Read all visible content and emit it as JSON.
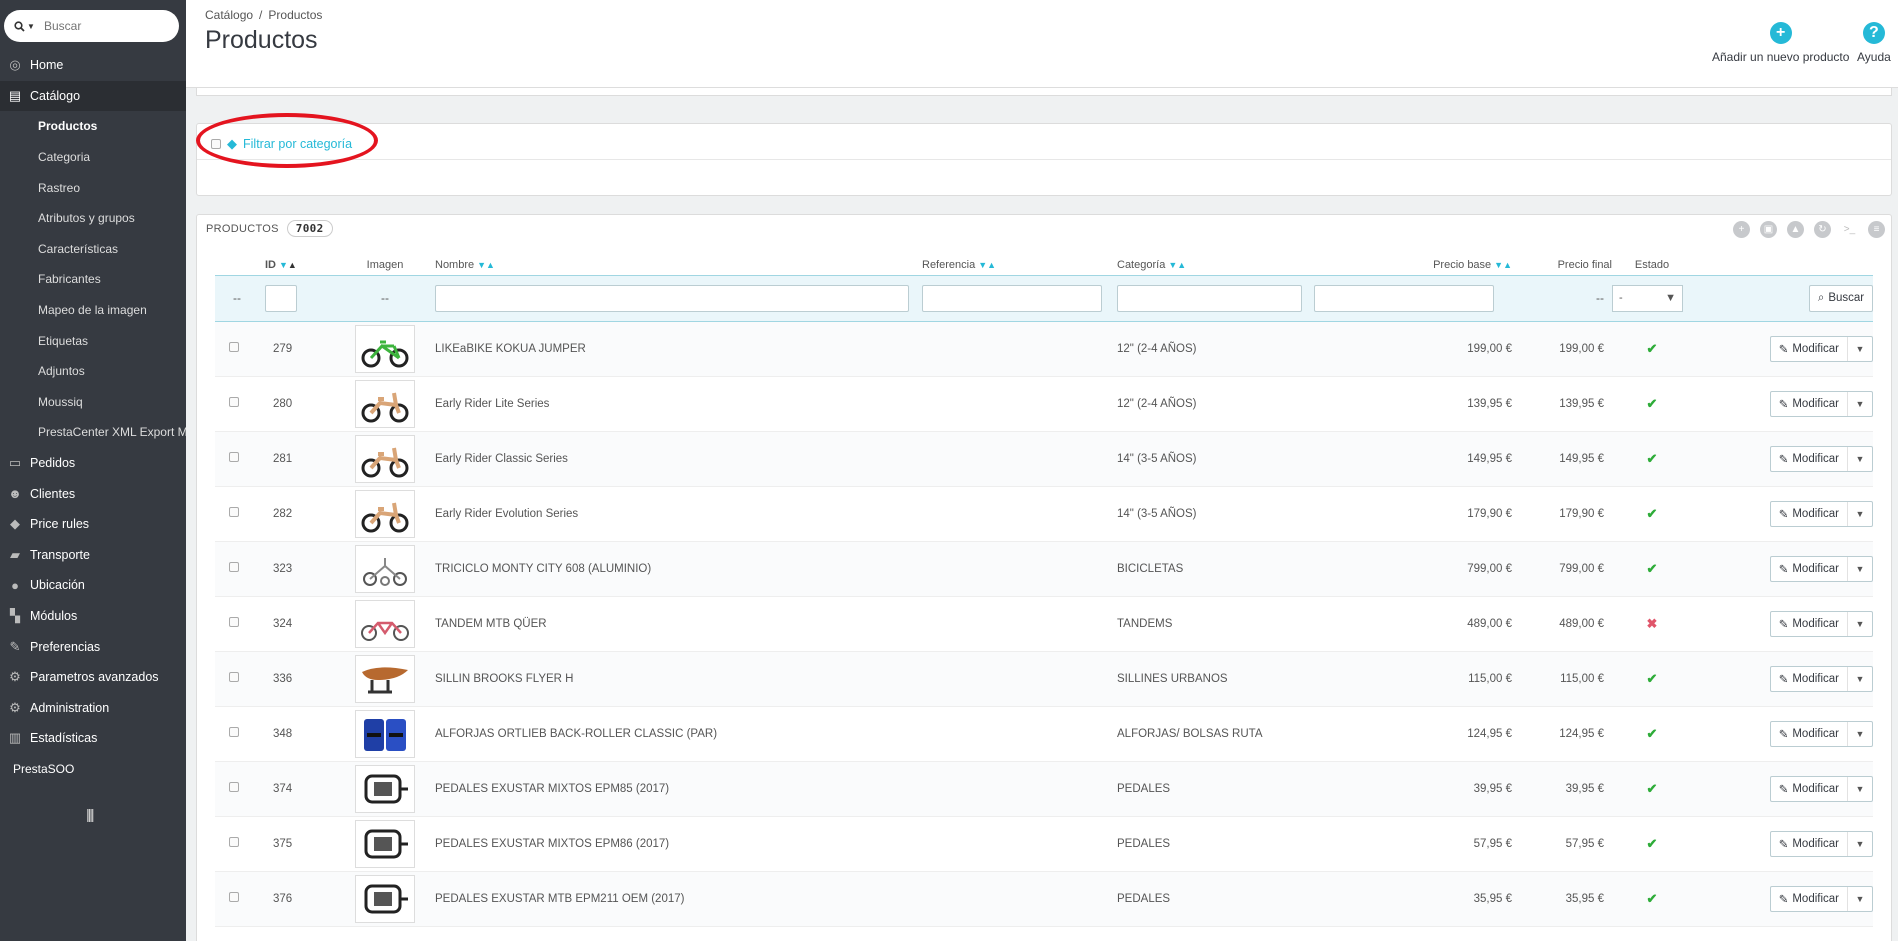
{
  "search": {
    "placeholder": "Buscar"
  },
  "sidebar": {
    "items": [
      {
        "label": "Home",
        "icon": "dashboard-icon",
        "glyph": "◎"
      },
      {
        "label": "Catálogo",
        "icon": "book-icon",
        "glyph": "▤"
      }
    ],
    "catalog_sub": [
      "Productos",
      "Categoria",
      "Rastreo",
      "Atributos y grupos",
      "Características",
      "Fabricantes",
      "Mapeo de la imagen",
      "Etiquetas",
      "Adjuntos",
      "Moussiq",
      "PrestaCenter XML Export M..."
    ],
    "items_after": [
      {
        "label": "Pedidos",
        "icon": "credit-card-icon",
        "glyph": "▭"
      },
      {
        "label": "Clientes",
        "icon": "users-icon",
        "glyph": "☻"
      },
      {
        "label": "Price rules",
        "icon": "tag-icon",
        "glyph": "◆"
      },
      {
        "label": "Transporte",
        "icon": "truck-icon",
        "glyph": "▰"
      },
      {
        "label": "Ubicación",
        "icon": "globe-icon",
        "glyph": "●"
      },
      {
        "label": "Módulos",
        "icon": "puzzle-icon",
        "glyph": "▚"
      },
      {
        "label": "Preferencias",
        "icon": "wrench-icon",
        "glyph": "✎"
      },
      {
        "label": "Parametros avanzados",
        "icon": "cogs-icon",
        "glyph": "⚙"
      },
      {
        "label": "Administration",
        "icon": "gear-icon",
        "glyph": "⚙"
      },
      {
        "label": "Estadísticas",
        "icon": "bar-chart-icon",
        "glyph": "▥"
      }
    ],
    "footer_label": "PrestaSOO",
    "collapse_glyph": "||||"
  },
  "header": {
    "breadcrumb": [
      "Catálogo",
      "Productos"
    ],
    "title": "Productos",
    "add_label": "Añadir un nuevo producto",
    "help_label": "Ayuda"
  },
  "filter": {
    "label": "Filtrar por categoría"
  },
  "products": {
    "heading": "Productos",
    "count": "7002",
    "columns": {
      "id": "ID",
      "image": "Imagen",
      "name": "Nombre",
      "reference": "Referencia",
      "category": "Categoría",
      "base_price": "Precio base",
      "final_price": "Precio final",
      "status": "Estado"
    },
    "filter_placeholders": {
      "dash": "--",
      "status_select": "-"
    },
    "search_button": "Buscar",
    "modify_label": "Modificar",
    "rows": [
      {
        "id": "279",
        "name": "LIKEaBIKE KOKUA JUMPER",
        "category": "12\" (2-4 AÑOS)",
        "base": "199,00 €",
        "final": "199,00 €",
        "active": true,
        "thumb": "bike-green"
      },
      {
        "id": "280",
        "name": "Early Rider Lite Series",
        "category": "12\" (2-4 AÑOS)",
        "base": "139,95 €",
        "final": "139,95 €",
        "active": true,
        "thumb": "bike-wood"
      },
      {
        "id": "281",
        "name": "Early Rider Classic Series",
        "category": "14\" (3-5 AÑOS)",
        "base": "149,95 €",
        "final": "149,95 €",
        "active": true,
        "thumb": "bike-wood"
      },
      {
        "id": "282",
        "name": "Early Rider Evolution Series",
        "category": "14\" (3-5 AÑOS)",
        "base": "179,90 €",
        "final": "179,90 €",
        "active": true,
        "thumb": "bike-wood"
      },
      {
        "id": "323",
        "name": "TRICICLO MONTY CITY 608 (ALUMINIO)",
        "category": "BICICLETAS",
        "base": "799,00 €",
        "final": "799,00 €",
        "active": true,
        "thumb": "trike"
      },
      {
        "id": "324",
        "name": "TANDEM MTB QÜER",
        "category": "TANDEMS",
        "base": "489,00 €",
        "final": "489,00 €",
        "active": false,
        "thumb": "tandem"
      },
      {
        "id": "336",
        "name": "SILLIN BROOKS FLYER H",
        "category": "SILLINES URBANOS",
        "base": "115,00 €",
        "final": "115,00 €",
        "active": true,
        "thumb": "saddle"
      },
      {
        "id": "348",
        "name": "ALFORJAS ORTLIEB BACK-ROLLER CLASSIC (PAR)",
        "category": "ALFORJAS/ BOLSAS RUTA",
        "base": "124,95 €",
        "final": "124,95 €",
        "active": true,
        "thumb": "bags"
      },
      {
        "id": "374",
        "name": "PEDALES EXUSTAR MIXTOS EPM85 (2017)",
        "category": "PEDALES",
        "base": "39,95 €",
        "final": "39,95 €",
        "active": true,
        "thumb": "pedal"
      },
      {
        "id": "375",
        "name": "PEDALES EXUSTAR MIXTOS EPM86 (2017)",
        "category": "PEDALES",
        "base": "57,95 €",
        "final": "57,95 €",
        "active": true,
        "thumb": "pedal"
      },
      {
        "id": "376",
        "name": "PEDALES EXUSTAR MTB EPM211 OEM (2017)",
        "category": "PEDALES",
        "base": "35,95 €",
        "final": "35,95 €",
        "active": true,
        "thumb": "pedal"
      }
    ]
  },
  "colors": {
    "accent": "#25b9d7",
    "sidebar": "#363a41",
    "ok": "#2eac39",
    "error": "#e0556a",
    "annotation": "#e4141f"
  }
}
